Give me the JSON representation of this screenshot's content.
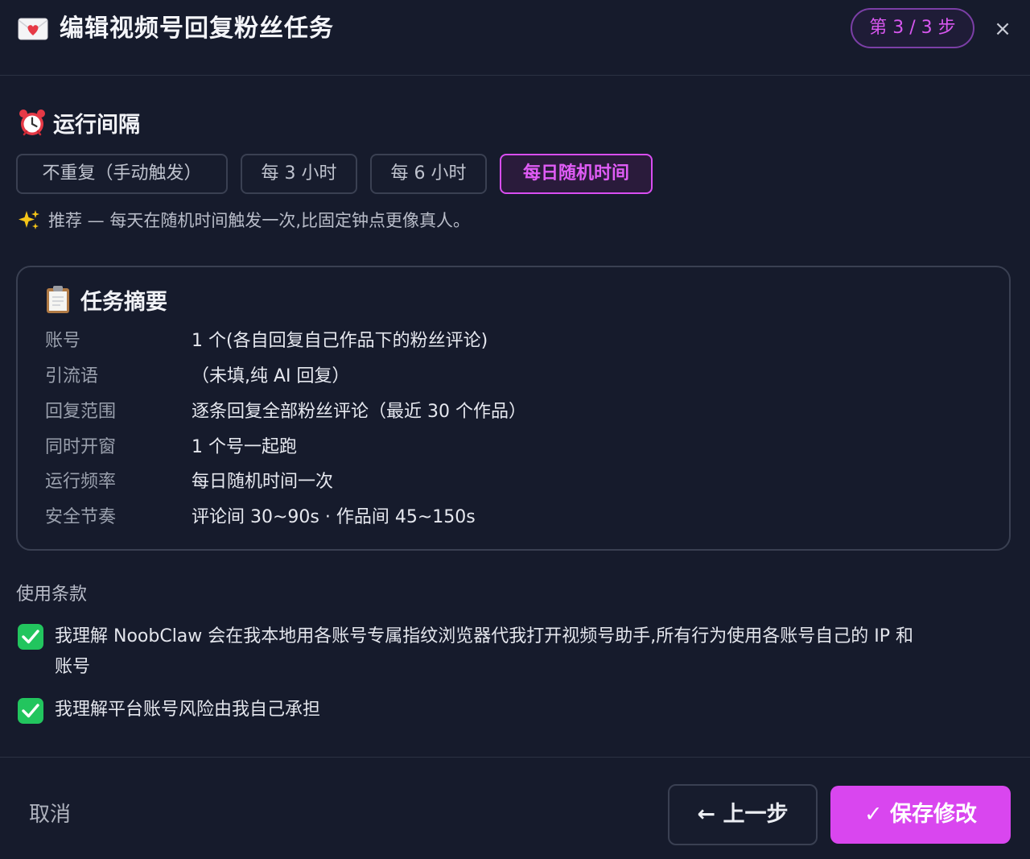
{
  "header": {
    "icon": "love-letter-icon",
    "title": "编辑视频号回复粉丝任务",
    "step_badge": "第 3 / 3 步",
    "close_glyph": "×"
  },
  "interval": {
    "icon": "alarm-clock-icon",
    "title": "运行间隔",
    "options": [
      {
        "label": "不重复（手动触发）",
        "active": false
      },
      {
        "label": "每 3 小时",
        "active": false
      },
      {
        "label": "每 6 小时",
        "active": false
      },
      {
        "label": "每日随机时间",
        "active": true
      }
    ],
    "hint_icon": "sparkles-icon",
    "hint": "推荐 — 每天在随机时间触发一次,比固定钟点更像真人。"
  },
  "summary": {
    "icon": "clipboard-icon",
    "title": "任务摘要",
    "rows": [
      {
        "key": "账号",
        "value": "1 个(各自回复自己作品下的粉丝评论)"
      },
      {
        "key": "引流语",
        "value": "（未填,纯 AI 回复）"
      },
      {
        "key": "回复范围",
        "value": "逐条回复全部粉丝评论（最近 30 个作品）"
      },
      {
        "key": "同时开窗",
        "value": "1 个号一起跑"
      },
      {
        "key": "运行频率",
        "value": "每日随机时间一次"
      },
      {
        "key": "安全节奏",
        "value": "评论间 30~90s · 作品间 45~150s"
      }
    ]
  },
  "terms": {
    "title": "使用条款",
    "items": [
      {
        "line1": "我理解 NoobClaw 会在我本地用各账号专属指纹浏览器代我打开视频号助手,所有行为使用各账号自己的 IP 和",
        "line2": "账号",
        "checked": true
      },
      {
        "line1": "我理解平台账号风险由我自己承担",
        "line2": "",
        "checked": true
      }
    ]
  },
  "footer": {
    "cancel": "取消",
    "prev": "← 上一步",
    "save": "✓ 保存修改"
  },
  "colors": {
    "accent": "#d946ef",
    "check": "#22c55e",
    "background": "#161b2c"
  }
}
